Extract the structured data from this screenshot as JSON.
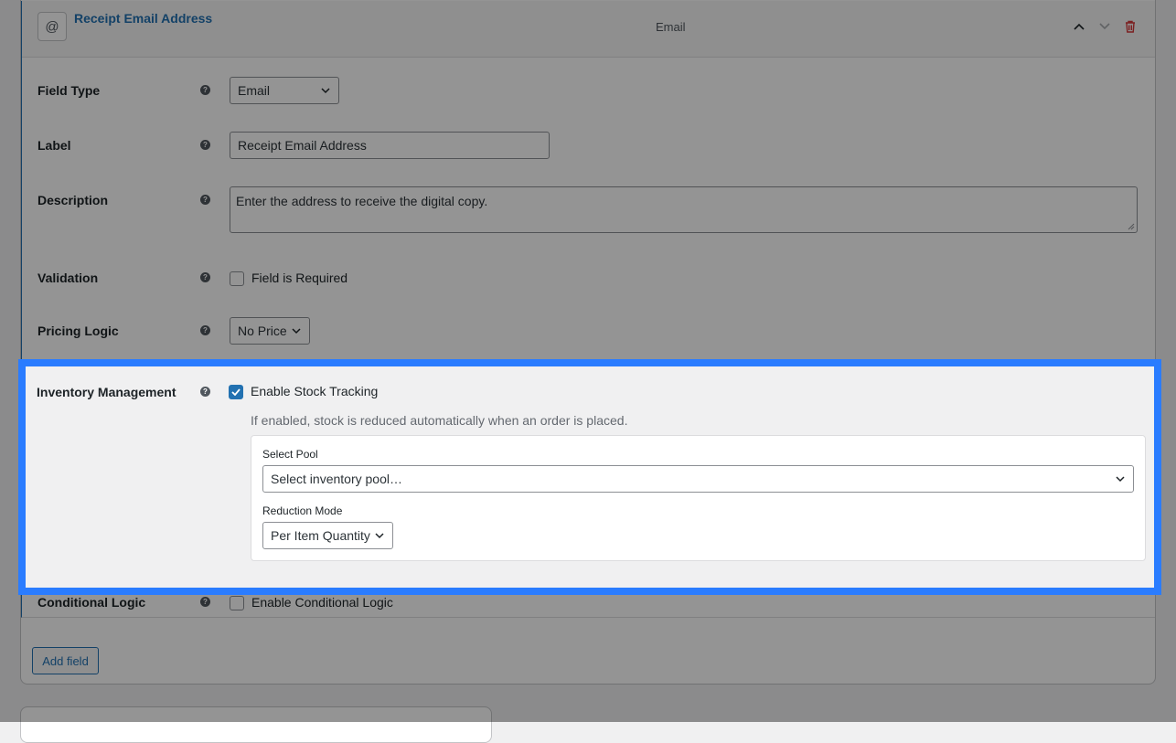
{
  "field": {
    "name": "Receipt Email Address",
    "type_tag": "Email",
    "icon": "at-icon"
  },
  "rows": {
    "field_type": {
      "label": "Field Type",
      "value": "Email"
    },
    "label": {
      "label": "Label",
      "value": "Receipt Email Address"
    },
    "description": {
      "label": "Description",
      "value": "Enter the address to receive the digital copy."
    },
    "validation": {
      "label": "Validation",
      "checkbox_label": "Field is Required",
      "checked": false
    },
    "pricing": {
      "label": "Pricing Logic",
      "value": "No Price"
    },
    "inventory": {
      "label": "Inventory Management",
      "checkbox_label": "Enable Stock Tracking",
      "checked": true,
      "help_text": "If enabled, stock is reduced automatically when an order is placed.",
      "pool_label": "Select Pool",
      "pool_placeholder": "Select inventory pool…",
      "mode_label": "Reduction Mode",
      "mode_value": "Per Item Quantity"
    },
    "conditional": {
      "label": "Conditional Logic",
      "checkbox_label": "Enable Conditional Logic",
      "checked": false
    }
  },
  "help_glyph": "?",
  "add_field_label": "Add field",
  "colors": {
    "accent": "#2271b1",
    "highlight": "#2a7cff",
    "delete": "#d63638"
  }
}
